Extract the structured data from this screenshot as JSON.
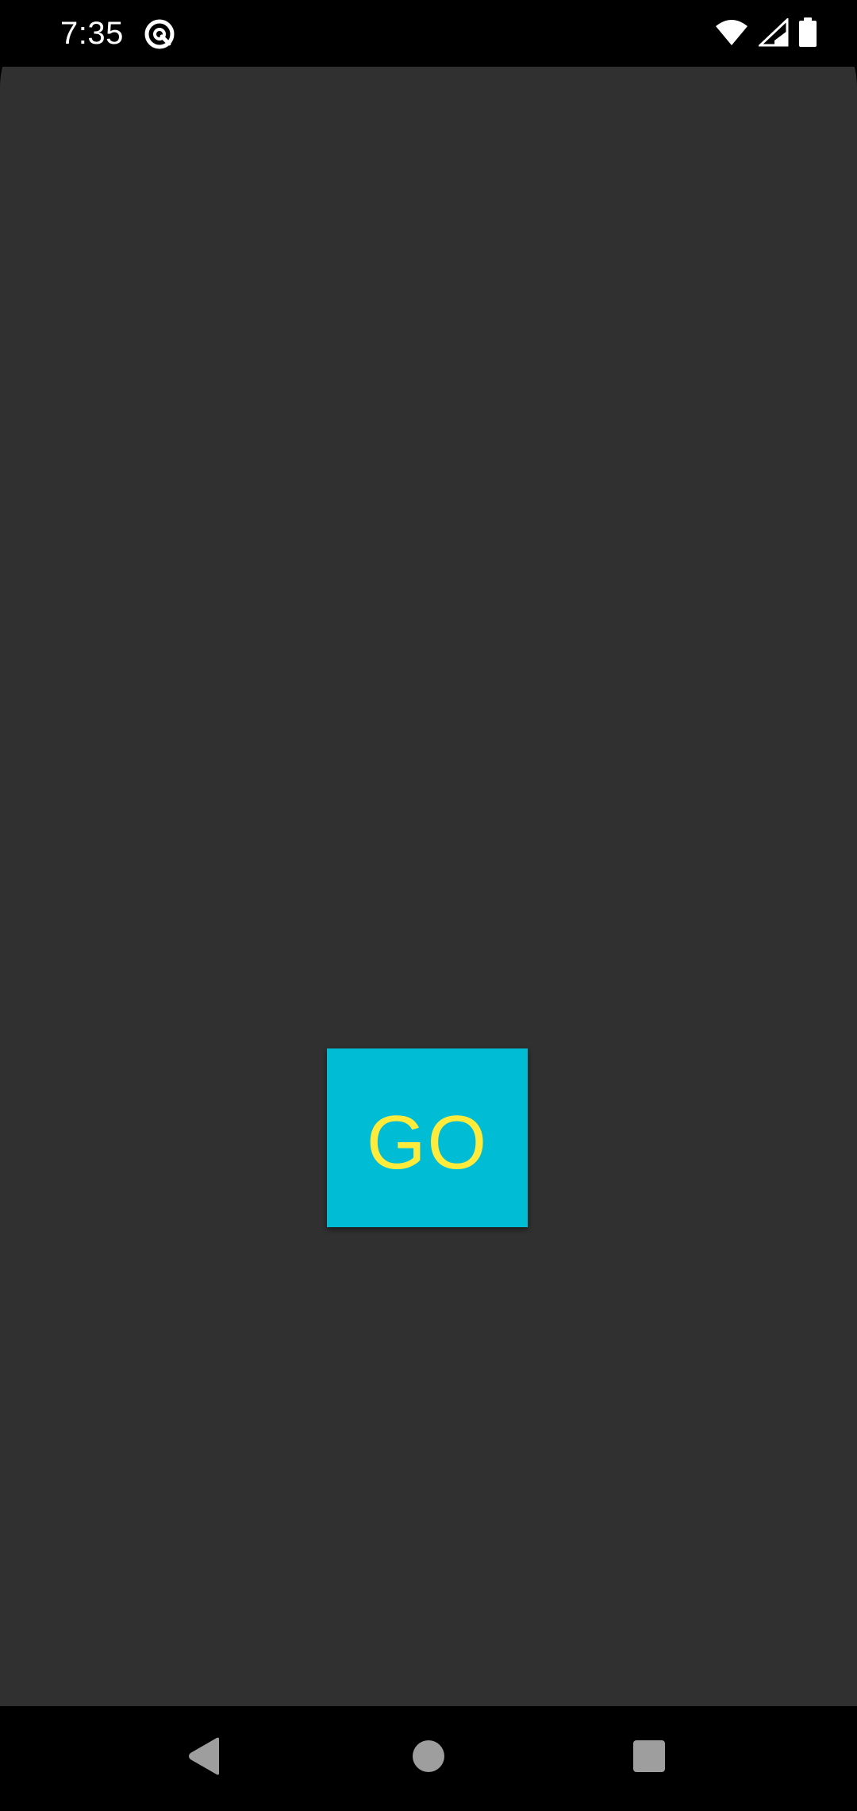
{
  "status_bar": {
    "time": "7:35",
    "app_icon": "quick-settings-app-icon",
    "icons": [
      "wifi-icon",
      "cell-signal-icon",
      "battery-icon"
    ]
  },
  "main": {
    "button_label": "GO",
    "button_color": "#00bcd4",
    "button_text_color": "#ffeb3b",
    "background_color": "#303030"
  },
  "nav_bar": {
    "icons": [
      "back-icon",
      "home-icon",
      "recents-icon"
    ]
  }
}
